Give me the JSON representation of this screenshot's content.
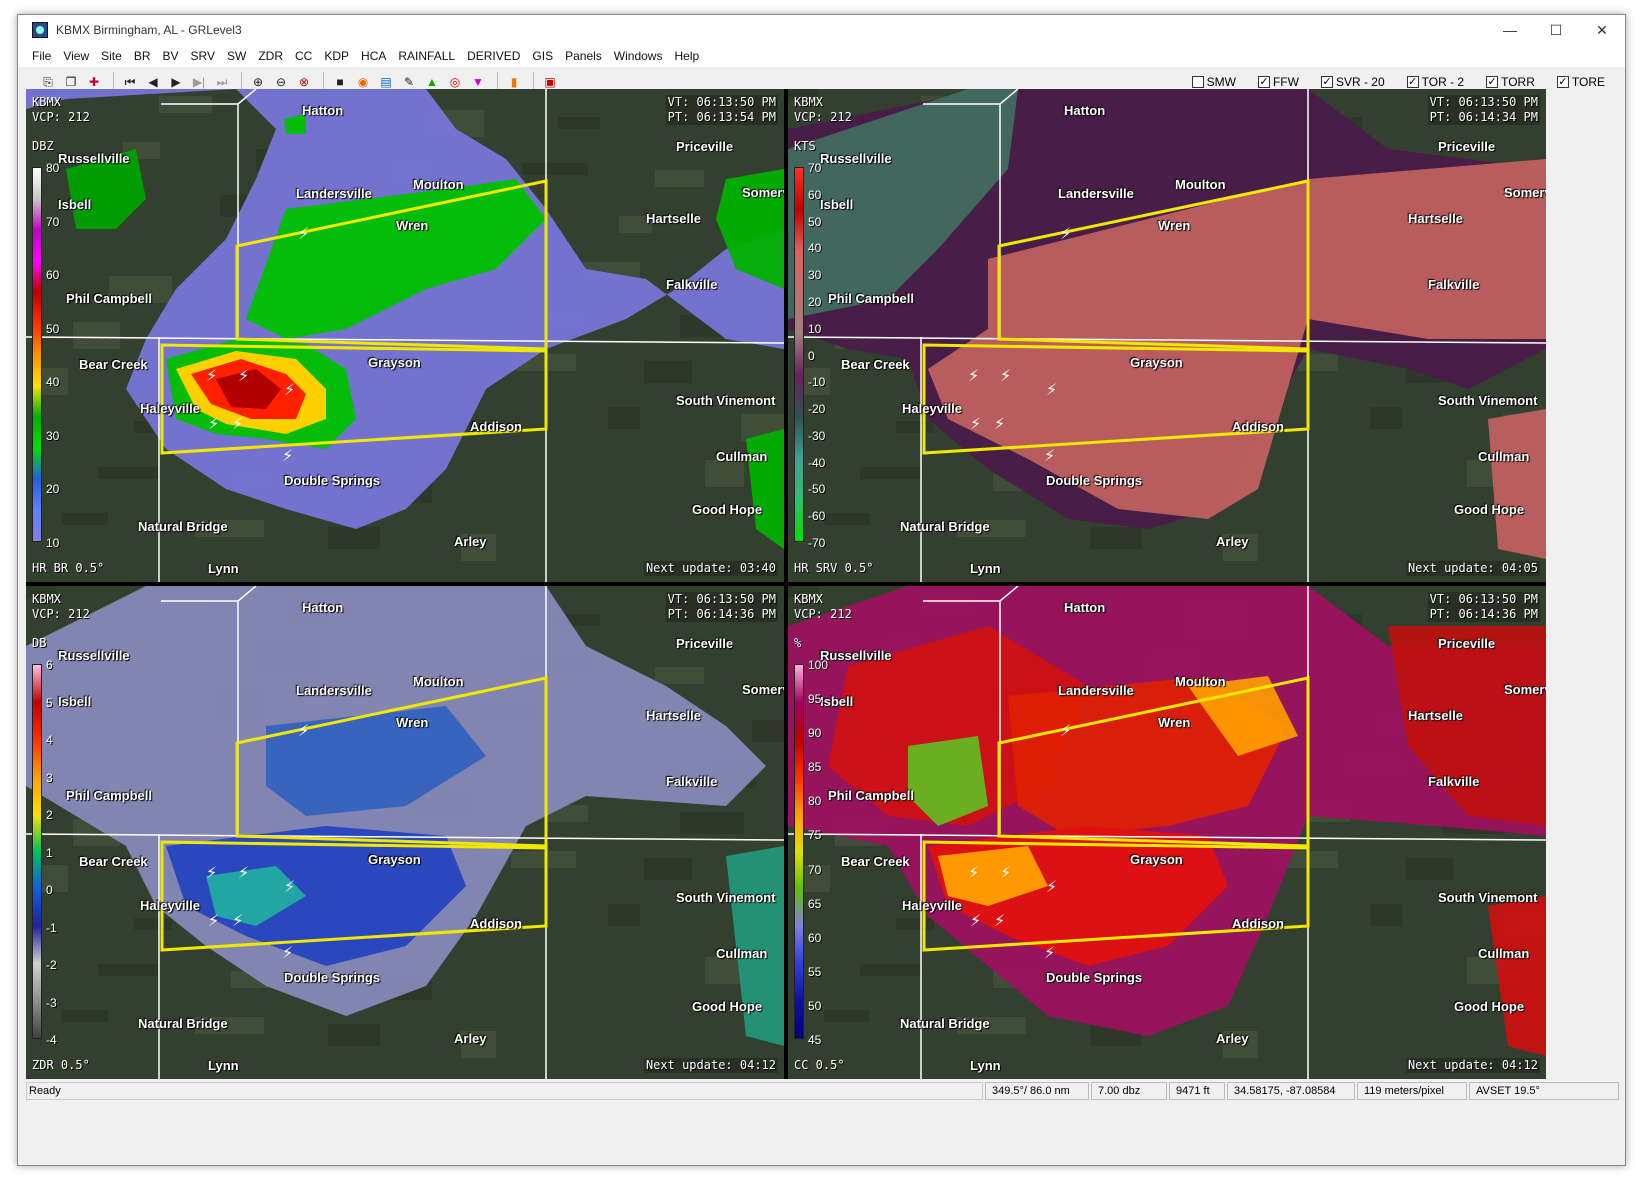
{
  "window": {
    "title": "KBMX Birmingham, AL - GRLevel3",
    "controls": [
      "—",
      "☐",
      "✕"
    ]
  },
  "menu": [
    "File",
    "View",
    "Site",
    "BR",
    "BV",
    "SRV",
    "SW",
    "ZDR",
    "CC",
    "KDP",
    "HCA",
    "RAINFALL",
    "DERIVED",
    "GIS",
    "Panels",
    "Windows",
    "Help"
  ],
  "warnings": [
    {
      "label": "SMW",
      "checked": false
    },
    {
      "label": "FFW",
      "checked": true
    },
    {
      "label": "SVR - 20",
      "checked": true
    },
    {
      "label": "TOR - 2",
      "checked": true
    },
    {
      "label": "TORR",
      "checked": true
    },
    {
      "label": "TORE",
      "checked": true
    }
  ],
  "colors": {
    "polygon": "#f0e800",
    "map_base": "#34402f",
    "boundary": "#ffffff"
  },
  "cities": [
    "Hatton",
    "Russellville",
    "Landersville",
    "Moulton",
    "Priceville",
    "Isbell",
    "Wren",
    "Hartselle",
    "Somerville",
    "Phil Campbell",
    "Falkville",
    "Bear Creek",
    "Grayson",
    "Haleyville",
    "South Vinemont",
    "Cullman",
    "Double Springs",
    "Good Hope",
    "Natural Bridge",
    "Arley",
    "Lynn",
    "Addison"
  ],
  "panels": [
    {
      "site": "KBMX",
      "vcp": "VCP: 212",
      "vt": "VT: 06:13:50 PM",
      "pt": "PT: 06:13:54 PM",
      "unit": "DBZ",
      "product": "HR BR 0.5°",
      "next": "Next update: 03:40",
      "legend": [
        "80",
        "70",
        "60",
        "50",
        "40",
        "30",
        "20",
        "10"
      ],
      "legend_gradient": [
        "#ffffff",
        "#c8c8c8",
        "#c000c0",
        "#ff00ff",
        "#c00000",
        "#ff3000",
        "#ff9000",
        "#ffe000",
        "#00b000",
        "#00e000",
        "#2060e0",
        "#6080ff",
        "#8080e0"
      ]
    },
    {
      "site": "KBMX",
      "vcp": "VCP: 212",
      "vt": "VT: 06:13:50 PM",
      "pt": "PT: 06:14:34 PM",
      "unit": "KTS",
      "product": "HR SRV 0.5°",
      "next": "Next update: 04:05",
      "legend": [
        "70",
        "60",
        "50",
        "40",
        "30",
        "20",
        "10",
        "0",
        "-10",
        "-20",
        "-30",
        "-40",
        "-50",
        "-60",
        "-70"
      ],
      "legend_gradient": [
        "#ff3030",
        "#c00000",
        "#e06060",
        "#c07070",
        "#a08080",
        "#6a2060",
        "#305050",
        "#40a090",
        "#30c070",
        "#00e000"
      ]
    },
    {
      "site": "KBMX",
      "vcp": "VCP: 212",
      "vt": "VT: 06:13:50 PM",
      "pt": "PT: 06:14:36 PM",
      "unit": "DB",
      "product": "ZDR 0.5°",
      "next": "Next update: 04:12",
      "legend": [
        "6",
        "5",
        "4",
        "3",
        "2",
        "1",
        "0",
        "-1",
        "-2",
        "-3",
        "-4"
      ],
      "legend_gradient": [
        "#ffc0e0",
        "#c00000",
        "#ff3000",
        "#ffa000",
        "#ffe000",
        "#00c060",
        "#1060e0",
        "#2020a0",
        "#d0d0d0",
        "#909090",
        "#404040"
      ]
    },
    {
      "site": "KBMX",
      "vcp": "VCP: 212",
      "vt": "VT: 06:13:50 PM",
      "pt": "PT: 06:14:36 PM",
      "unit": "%",
      "product": "CC 0.5°",
      "next": "Next update: 04:12",
      "legend": [
        "100",
        "95",
        "90",
        "85",
        "80",
        "75",
        "70",
        "65",
        "60",
        "55",
        "50",
        "45"
      ],
      "legend_gradient": [
        "#ffb0e0",
        "#a00060",
        "#c00000",
        "#ff3000",
        "#ffa000",
        "#e0e000",
        "#60c000",
        "#8080e0",
        "#3040e0",
        "#1010a0",
        "#000080"
      ]
    }
  ],
  "status": {
    "ready": "Ready",
    "bearing": "349.5°/ 86.0 nm",
    "value": "7.00 dbz",
    "height": "9471 ft",
    "latlon": "34.58175, -87.08584",
    "resolution": "119 meters/pixel",
    "avset": "AVSET 19.5°"
  }
}
